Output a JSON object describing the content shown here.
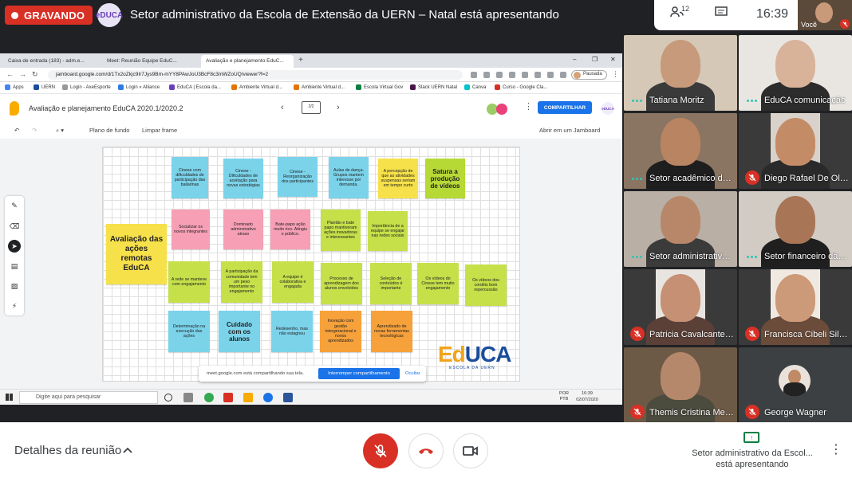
{
  "topbar": {
    "recording_label": "GRAVANDO",
    "presenter_logo_text": "eDUCA",
    "presenter_title": "Setor administrativo da Escola de Extensão da UERN – Natal está apresentando",
    "people_count": "12",
    "clock": "16:39",
    "self_label": "Você"
  },
  "browser": {
    "tabs": [
      {
        "label": "Caixa de entrada (183) - adm.e..."
      },
      {
        "label": "Meet: Reunião Equipe EduC..."
      },
      {
        "label": "Avaliação e planejamento EduC..."
      }
    ],
    "url": "jamboard.google.com/d/1Tx2oZkjc9Ir7Jys9Bm-mYY8PAwJoU3BcF8c3mWZoUQ/viewer?f=2",
    "profile_label": "Pausada",
    "bookmarks": [
      "Apps",
      "UERN",
      "Login - AxeEsporte",
      "Login « Alliance",
      "EduCA | Escola da...",
      "Ambiente Virtual d...",
      "Ambiente Virtual d...",
      "Escola Virtual Gov",
      "Slack UERN Natal",
      "Canva",
      "Curso - Google Cla..."
    ]
  },
  "jamboard": {
    "title": "Avaliação e planejamento EduCA 2020.1/2020.2",
    "frame_indicator": "2/2",
    "share_label": "COMPARTILHAR",
    "mini_logo": "eDUCA",
    "toolbar": {
      "background": "Plano de fundo",
      "clear": "Limpar frame",
      "open_in": "Abrir em um Jamboard"
    },
    "notes": [
      {
        "text": "Cinese com dificuldades de participação das bailarinas",
        "color": "blue"
      },
      {
        "text": "Cinese - Dificuldades de aceitação para novas estratégias",
        "color": "blue"
      },
      {
        "text": "Cinese - Reorganização dos participantes",
        "color": "blue"
      },
      {
        "text": "Aulas de dança. Grupos mantem interesse por demanda.",
        "color": "blue"
      },
      {
        "text": "A percepção de que as atividades suspensas seriam em tempo curto",
        "color": "yellow"
      },
      {
        "text": "Satura a produção de vídeos",
        "color": "lime"
      },
      {
        "text": "Socializar os novos integrantes",
        "color": "pink"
      },
      {
        "text": "Dominado adminstrativo atraso",
        "color": "pink"
      },
      {
        "text": "Bate-papo ação muito rico. Atingiu o público.",
        "color": "pink"
      },
      {
        "text": "Plantão e bate papo mantiveram ações inovadoras e interessantes",
        "color": "green"
      },
      {
        "text": "Importância de a equipe se engajar nas redes sociais",
        "color": "green"
      },
      {
        "text": "Avaliação das ações remotas EduCA",
        "color": "yellow"
      },
      {
        "text": "A rede se manteve com engajamento",
        "color": "green"
      },
      {
        "text": "A participação da comunidade tem um peso importante no engajamento",
        "color": "green"
      },
      {
        "text": "A equipe é colaborativa e engajada",
        "color": "green"
      },
      {
        "text": "Processo de aprendizagem dos alunos envolvidos",
        "color": "green"
      },
      {
        "text": "Seleção de conteúdos é importante",
        "color": "green"
      },
      {
        "text": "Os vídeos do Cinese tem muito engajamento",
        "color": "green"
      },
      {
        "text": "Os vídeos dos cordéis bom repercussão",
        "color": "green"
      },
      {
        "text": "Determinação na execução das ações",
        "color": "blue"
      },
      {
        "text": "Cuidado com os alunos",
        "color": "blue"
      },
      {
        "text": "Redesenho, mas não estagnou",
        "color": "blue"
      },
      {
        "text": "Inovação com gestão intergeracional e novos aprendizados",
        "color": "orange"
      },
      {
        "text": "Aprendizado de novas ferramentas tecnológicas",
        "color": "orange"
      }
    ],
    "logo": {
      "main_a": "Ed",
      "main_b": "UCA",
      "sub": "ESCOLA DA UERN"
    },
    "share_notice": {
      "message": "meet.google.com está compartilhando sua tela.",
      "stop": "Interromper compartilhamento",
      "hide": "Ocultar"
    }
  },
  "taskbar": {
    "search_placeholder": "Digite aqui para pesquisar",
    "lang": "POR PTB",
    "time": "16:39",
    "date": "02/07/2020"
  },
  "participants": [
    {
      "name": "Tatiana Moritz",
      "muted": false
    },
    {
      "name": "EduCA comunicação",
      "muted": false
    },
    {
      "name": "Setor acadêmico da ...",
      "muted": false
    },
    {
      "name": "Diego Rafael De Oliv...",
      "muted": true
    },
    {
      "name": "Setor administrativo ...",
      "muted": false
    },
    {
      "name": "Setor financeiro da E...",
      "muted": false
    },
    {
      "name": "Patricia Cavalcante d...",
      "muted": true
    },
    {
      "name": "Francisca Cibeli Silva...",
      "muted": true
    },
    {
      "name": "Themis Cristina Mes...",
      "muted": true
    },
    {
      "name": "George Wagner",
      "muted": true
    }
  ],
  "bottombar": {
    "details_label": "Detalhes da reunião",
    "presenting_line1": "Setor administrativo da Escol...",
    "presenting_line2": "está apresentando"
  },
  "colors": {
    "recording": "#d93025",
    "accent": "#1a73e8",
    "speaking": "#2ec4b6"
  }
}
